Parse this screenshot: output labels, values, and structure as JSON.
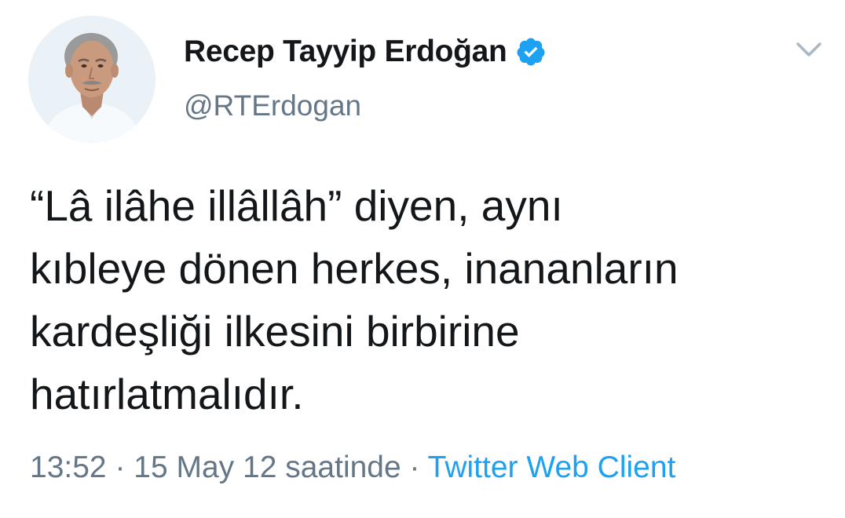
{
  "author": {
    "display_name": "Recep Tayyip Erdoğan",
    "handle": "@RTErdogan",
    "verified": true,
    "verified_icon": "verified-badge-icon",
    "avatar_icon": "profile-photo"
  },
  "menu": {
    "icon": "chevron-down-icon"
  },
  "tweet": {
    "lines": [
      "“Lâ ilâhe illâllâh” diyen, aynı",
      "kıbleye dönen herkes, inananların",
      "kardeşliği ilkesini birbirine",
      "hatırlatmalıdır."
    ]
  },
  "meta": {
    "time": "13:52",
    "separator": " · ",
    "date": "15 May 12 saatinde",
    "source": "Twitter Web Client"
  },
  "colors": {
    "text": "#14171a",
    "secondary": "#657786",
    "link": "#1da1f2",
    "verified": "#1da1f2"
  }
}
